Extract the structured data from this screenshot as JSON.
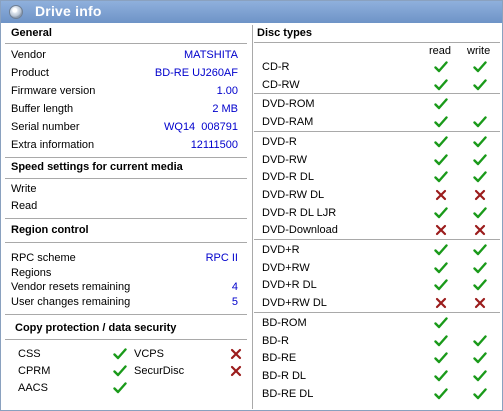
{
  "window": {
    "title": "Drive info",
    "icon": "drive-icon"
  },
  "general": {
    "heading": "General",
    "rows": [
      {
        "label": "Vendor",
        "value": "MATSHITA"
      },
      {
        "label": "Product",
        "value": "BD-RE UJ260AF"
      },
      {
        "label": "Firmware version",
        "value": "1.00"
      },
      {
        "label": "Buffer length",
        "value": "2 MB"
      },
      {
        "label": "Serial number",
        "value": "WQ14  008791"
      },
      {
        "label": "Extra information",
        "value": "12111500"
      }
    ]
  },
  "speed": {
    "heading": "Speed settings for current media",
    "rows": [
      {
        "label": "Write"
      },
      {
        "label": "Read"
      }
    ]
  },
  "region": {
    "heading": "Region control",
    "rows": [
      {
        "label": "RPC scheme",
        "value": "RPC II"
      },
      {
        "label": "Regions",
        "value": ""
      },
      {
        "label": "Vendor resets remaining",
        "value": "4"
      },
      {
        "label": "User changes remaining",
        "value": "5"
      }
    ]
  },
  "copy_protection": {
    "heading": "Copy protection / data security",
    "items": [
      {
        "label": "CSS",
        "supported": true
      },
      {
        "label": "VCPS",
        "supported": false
      },
      {
        "label": "CPRM",
        "supported": true
      },
      {
        "label": "SecurDisc",
        "supported": false
      },
      {
        "label": "AACS",
        "supported": true
      }
    ]
  },
  "disc_types": {
    "heading": "Disc types",
    "columns": {
      "read": "read",
      "write": "write"
    },
    "groups": [
      [
        {
          "name": "CD-R",
          "read": true,
          "write": true
        },
        {
          "name": "CD-RW",
          "read": true,
          "write": true
        }
      ],
      [
        {
          "name": "DVD-ROM",
          "read": true,
          "write": null
        },
        {
          "name": "DVD-RAM",
          "read": true,
          "write": true
        }
      ],
      [
        {
          "name": "DVD-R",
          "read": true,
          "write": true
        },
        {
          "name": "DVD-RW",
          "read": true,
          "write": true
        },
        {
          "name": "DVD-R DL",
          "read": true,
          "write": true
        },
        {
          "name": "DVD-RW DL",
          "read": false,
          "write": false
        },
        {
          "name": "DVD-R DL LJR",
          "read": true,
          "write": true
        },
        {
          "name": "DVD-Download",
          "read": false,
          "write": false
        }
      ],
      [
        {
          "name": "DVD+R",
          "read": true,
          "write": true
        },
        {
          "name": "DVD+RW",
          "read": true,
          "write": true
        },
        {
          "name": "DVD+R DL",
          "read": true,
          "write": true
        },
        {
          "name": "DVD+RW DL",
          "read": false,
          "write": false
        }
      ],
      [
        {
          "name": "BD-ROM",
          "read": true,
          "write": null
        },
        {
          "name": "BD-R",
          "read": true,
          "write": true
        },
        {
          "name": "BD-RE",
          "read": true,
          "write": true
        },
        {
          "name": "BD-R DL",
          "read": true,
          "write": true
        },
        {
          "name": "BD-RE DL",
          "read": true,
          "write": true
        }
      ]
    ]
  },
  "colors": {
    "check": "#1a9a1a",
    "cross": "#9b1c1c",
    "value": "#0000cc",
    "title_bar": "#7a9ccf"
  }
}
